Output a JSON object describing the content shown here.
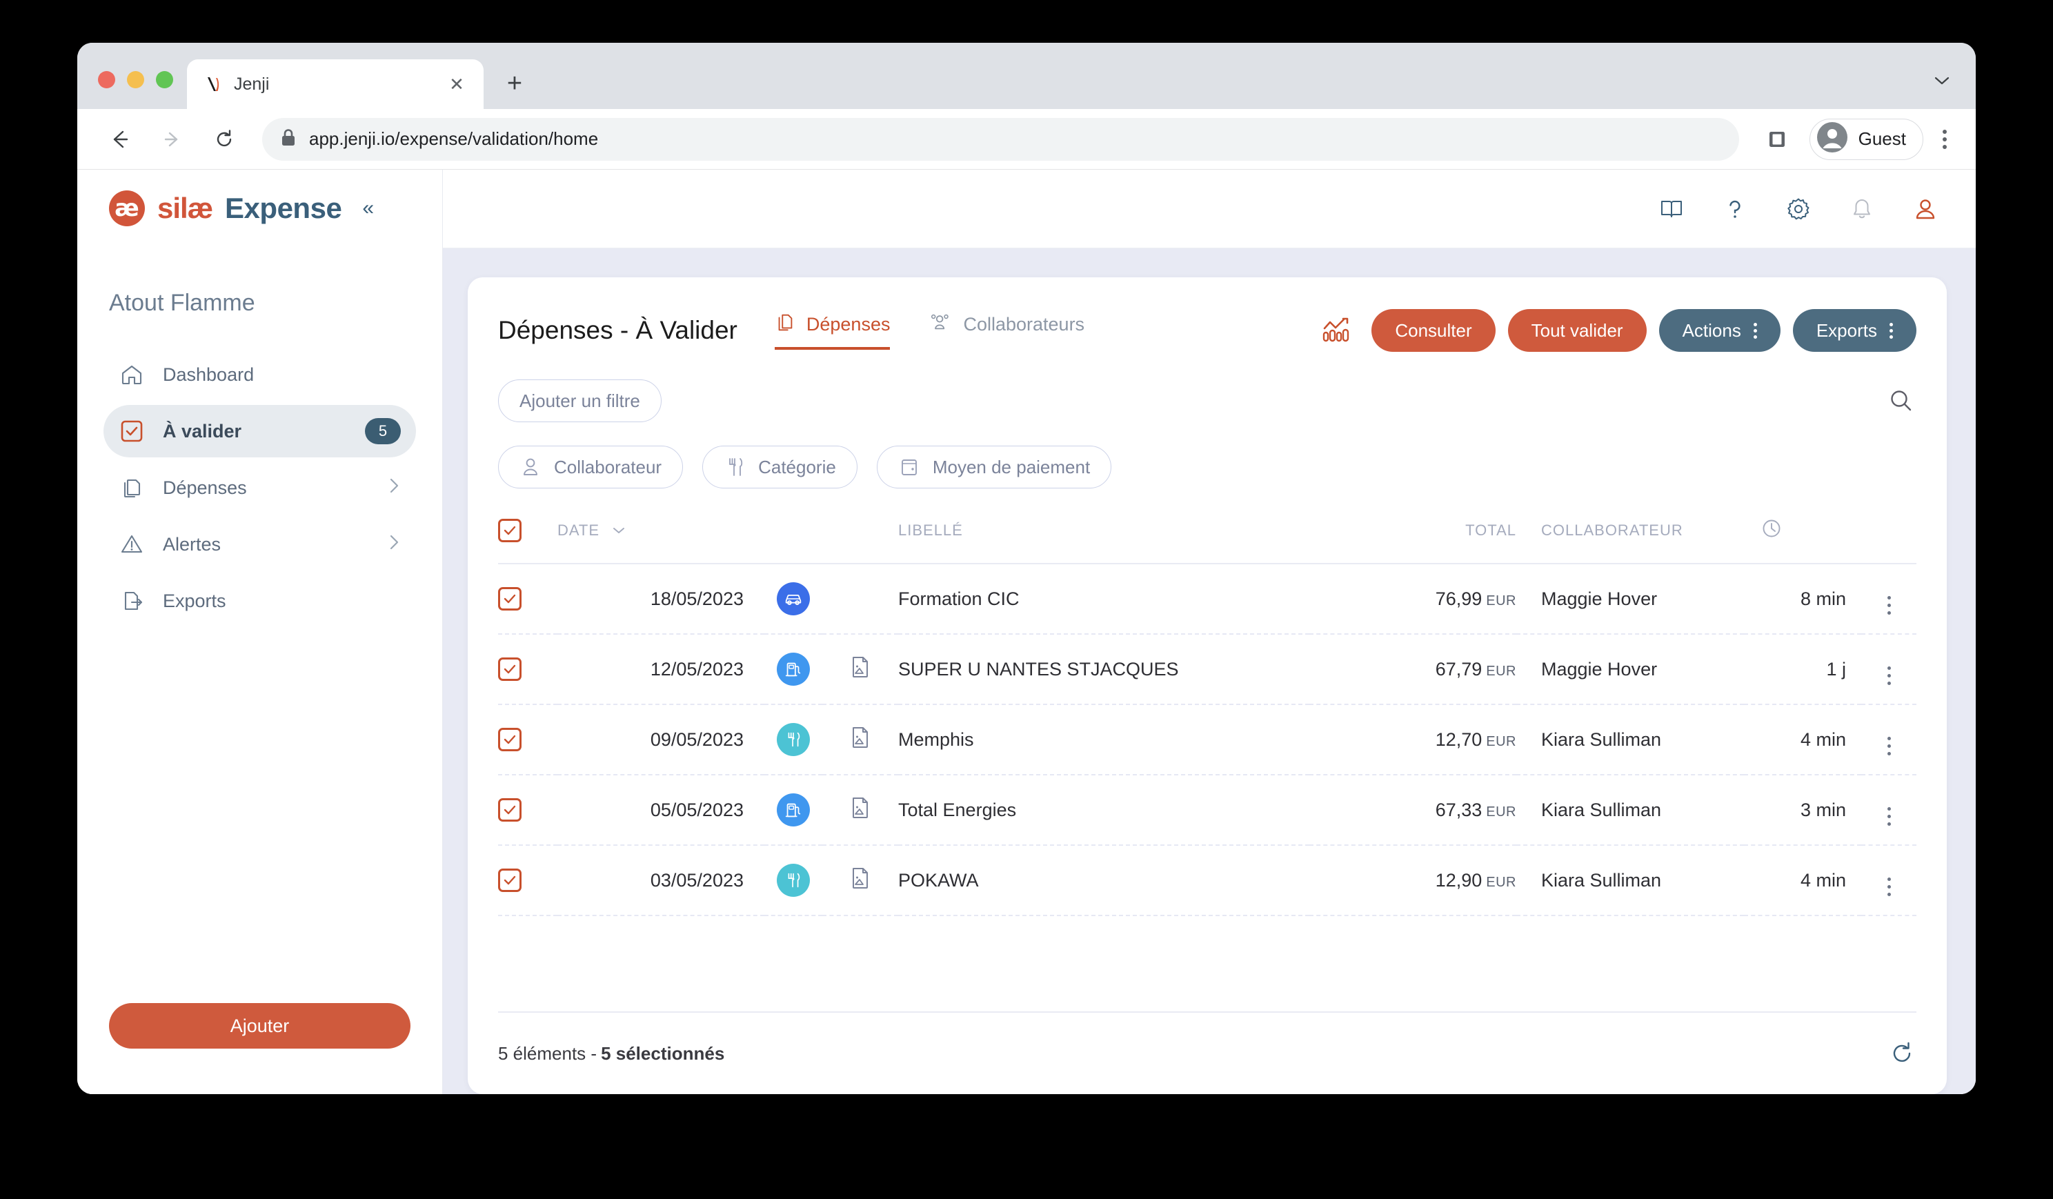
{
  "browser": {
    "tab_title": "Jenji",
    "url": "app.jenji.io/expense/validation/home",
    "profile_label": "Guest",
    "new_tab_glyph": "+",
    "close_glyph": "✕",
    "tabstrip_menu_glyph": "⌄"
  },
  "sidebar": {
    "logo_mark": "æ",
    "logo_brand": "silæ",
    "logo_product": "Expense",
    "collapse_glyph": "«",
    "company": "Atout Flamme",
    "items": [
      {
        "label": "Dashboard",
        "icon": "home-icon",
        "badge": null,
        "chevron": false,
        "active": false
      },
      {
        "label": "À valider",
        "icon": "checkbox-icon",
        "badge": "5",
        "chevron": false,
        "active": true
      },
      {
        "label": "Dépenses",
        "icon": "documents-icon",
        "badge": null,
        "chevron": true,
        "active": false
      },
      {
        "label": "Alertes",
        "icon": "warning-icon",
        "badge": null,
        "chevron": true,
        "active": false
      },
      {
        "label": "Exports",
        "icon": "export-icon",
        "badge": null,
        "chevron": false,
        "active": false
      }
    ],
    "add_button": "Ajouter"
  },
  "topbar": {
    "icons": [
      "book-icon",
      "help-icon",
      "gear-icon",
      "bell-icon",
      "user-icon"
    ]
  },
  "page": {
    "title": "Dépenses - À Valider",
    "tabs": [
      {
        "label": "Dépenses",
        "icon": "documents-icon",
        "active": true
      },
      {
        "label": "Collaborateurs",
        "icon": "people-icon",
        "active": false
      }
    ],
    "actions": [
      {
        "label": "Consulter",
        "style": "orange",
        "menu": false
      },
      {
        "label": "Tout valider",
        "style": "orange",
        "menu": false
      },
      {
        "label": "Actions",
        "style": "slate",
        "menu": true
      },
      {
        "label": "Exports",
        "style": "slate",
        "menu": true
      }
    ],
    "chart_icon": "analytics-icon",
    "add_filter": "Ajouter un filtre",
    "filters": [
      {
        "label": "Collaborateur",
        "icon": "person-icon"
      },
      {
        "label": "Catégorie",
        "icon": "cutlery-icon"
      },
      {
        "label": "Moyen de paiement",
        "icon": "card-icon"
      }
    ],
    "search_icon": "search-icon"
  },
  "table": {
    "columns": {
      "date": "DATE",
      "libelle": "LIBELLÉ",
      "total": "TOTAL",
      "collaborateur": "COLLABORATEUR",
      "time": "clock-icon"
    },
    "sort_glyph": "⌄",
    "rows": [
      {
        "checked": true,
        "date": "18/05/2023",
        "category": "car",
        "receipt": false,
        "libelle": "Formation CIC",
        "amount": "76,99",
        "currency": "EUR",
        "collaborateur": "Maggie Hover",
        "time": "8 min"
      },
      {
        "checked": true,
        "date": "12/05/2023",
        "category": "fuel",
        "receipt": true,
        "libelle": "SUPER U NANTES STJACQUES",
        "amount": "67,79",
        "currency": "EUR",
        "collaborateur": "Maggie Hover",
        "time": "1 j"
      },
      {
        "checked": true,
        "date": "09/05/2023",
        "category": "food",
        "receipt": true,
        "libelle": "Memphis",
        "amount": "12,70",
        "currency": "EUR",
        "collaborateur": "Kiara Sulliman",
        "time": "4 min"
      },
      {
        "checked": true,
        "date": "05/05/2023",
        "category": "fuel",
        "receipt": true,
        "libelle": "Total Energies",
        "amount": "67,33",
        "currency": "EUR",
        "collaborateur": "Kiara Sulliman",
        "time": "3 min"
      },
      {
        "checked": true,
        "date": "03/05/2023",
        "category": "food",
        "receipt": true,
        "libelle": "POKAWA",
        "amount": "12,90",
        "currency": "EUR",
        "collaborateur": "Kiara Sulliman",
        "time": "4 min"
      }
    ]
  },
  "footer": {
    "count_text": "5 éléments - ",
    "selected_text": "5 sélectionnés",
    "refresh_icon": "refresh-icon"
  },
  "colors": {
    "brand_orange": "#cf5a3d",
    "brand_slate": "#4d6c80",
    "accent_red": "#c8502c",
    "cat_car": "#3b6ee8",
    "cat_fuel": "#3f97ef",
    "cat_food": "#4cc3d4",
    "canvas": "#e8eaf4"
  }
}
